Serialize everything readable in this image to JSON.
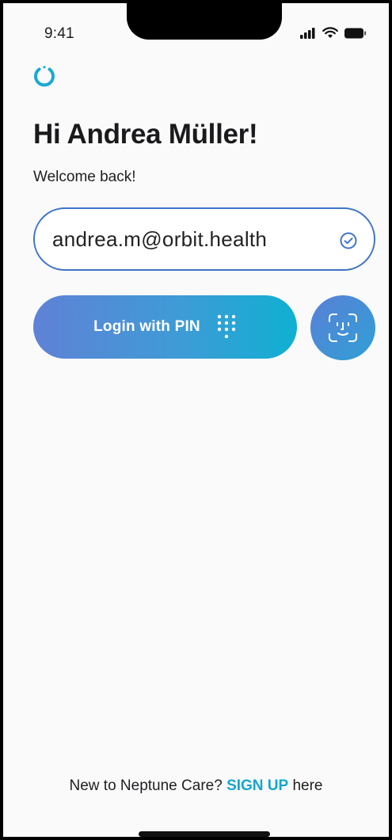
{
  "status_bar": {
    "time": "9:41",
    "icons": [
      "signal-icon",
      "wifi-icon",
      "battery-icon"
    ]
  },
  "app": {
    "logo_icon": "circular-logo-icon",
    "brand_color": "#1aa9d2"
  },
  "welcome": {
    "greeting": "Hi Andrea Müller!",
    "subtitle": "Welcome back!"
  },
  "login": {
    "email_value": "andrea.m@orbit.health",
    "email_status_icon": "check-circle-icon",
    "pin_button_label": "Login with PIN",
    "pin_button_icon": "keypad-icon",
    "faceid_button_icon": "face-id-icon",
    "accent_gradient": [
      "#5f81d6",
      "#0fb0d2"
    ]
  },
  "footer": {
    "prefix": "New to Neptune Care?",
    "signup_link": "SIGN UP",
    "suffix": "here"
  }
}
